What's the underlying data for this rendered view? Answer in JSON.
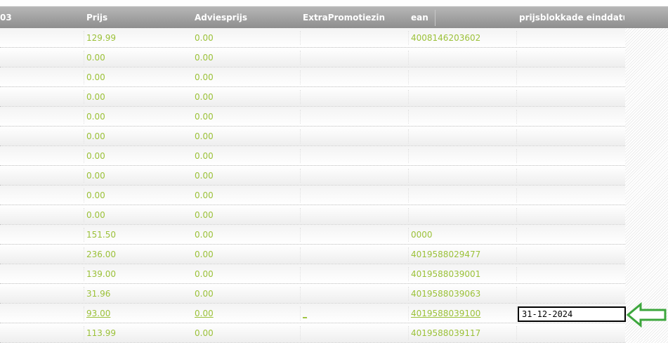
{
  "table": {
    "columns": [
      {
        "key": "partial",
        "label": "03"
      },
      {
        "key": "prijs",
        "label": "Prijs"
      },
      {
        "key": "adviesprijs",
        "label": "Adviesprijs"
      },
      {
        "key": "extra",
        "label": "ExtraPromotiezin"
      },
      {
        "key": "ean",
        "label": "ean"
      },
      {
        "key": "blokkade",
        "label": "prijsblokkade einddatu"
      }
    ],
    "rows": [
      {
        "prijs": "129.99",
        "adviesprijs": "0.00",
        "extra": "",
        "ean": "4008146203602"
      },
      {
        "prijs": "0.00",
        "adviesprijs": "0.00",
        "extra": "",
        "ean": ""
      },
      {
        "prijs": "0.00",
        "adviesprijs": "0.00",
        "extra": "",
        "ean": ""
      },
      {
        "prijs": "0.00",
        "adviesprijs": "0.00",
        "extra": "",
        "ean": ""
      },
      {
        "prijs": "0.00",
        "adviesprijs": "0.00",
        "extra": "",
        "ean": ""
      },
      {
        "prijs": "0.00",
        "adviesprijs": "0.00",
        "extra": "",
        "ean": ""
      },
      {
        "prijs": "0.00",
        "adviesprijs": "0.00",
        "extra": "",
        "ean": ""
      },
      {
        "prijs": "0.00",
        "adviesprijs": "0.00",
        "extra": "",
        "ean": ""
      },
      {
        "prijs": "0.00",
        "adviesprijs": "0.00",
        "extra": "",
        "ean": ""
      },
      {
        "prijs": "0.00",
        "adviesprijs": "0.00",
        "extra": "",
        "ean": ""
      },
      {
        "prijs": "151.50",
        "adviesprijs": "0.00",
        "extra": "",
        "ean": "0000"
      },
      {
        "prijs": "236.00",
        "adviesprijs": "0.00",
        "extra": "",
        "ean": "4019588029477"
      },
      {
        "prijs": "139.00",
        "adviesprijs": "0.00",
        "extra": "",
        "ean": "4019588039001"
      },
      {
        "prijs": "31.96",
        "adviesprijs": "0.00",
        "extra": "",
        "ean": "4019588039063"
      },
      {
        "prijs": "93.00",
        "adviesprijs": "0.00",
        "extra": "_",
        "ean": "4019588039100",
        "selected": true
      },
      {
        "prijs": "113.99",
        "adviesprijs": "0.00",
        "extra": "",
        "ean": "4019588039117"
      }
    ],
    "edit_input": {
      "value": "31-12-2024",
      "row_index": 14
    }
  },
  "colors": {
    "cell_text": "#9bc138",
    "header_bg": "#9e9e9e",
    "arrow": "#3ca63c"
  },
  "icons": {
    "annotation": "arrow-left-icon"
  }
}
